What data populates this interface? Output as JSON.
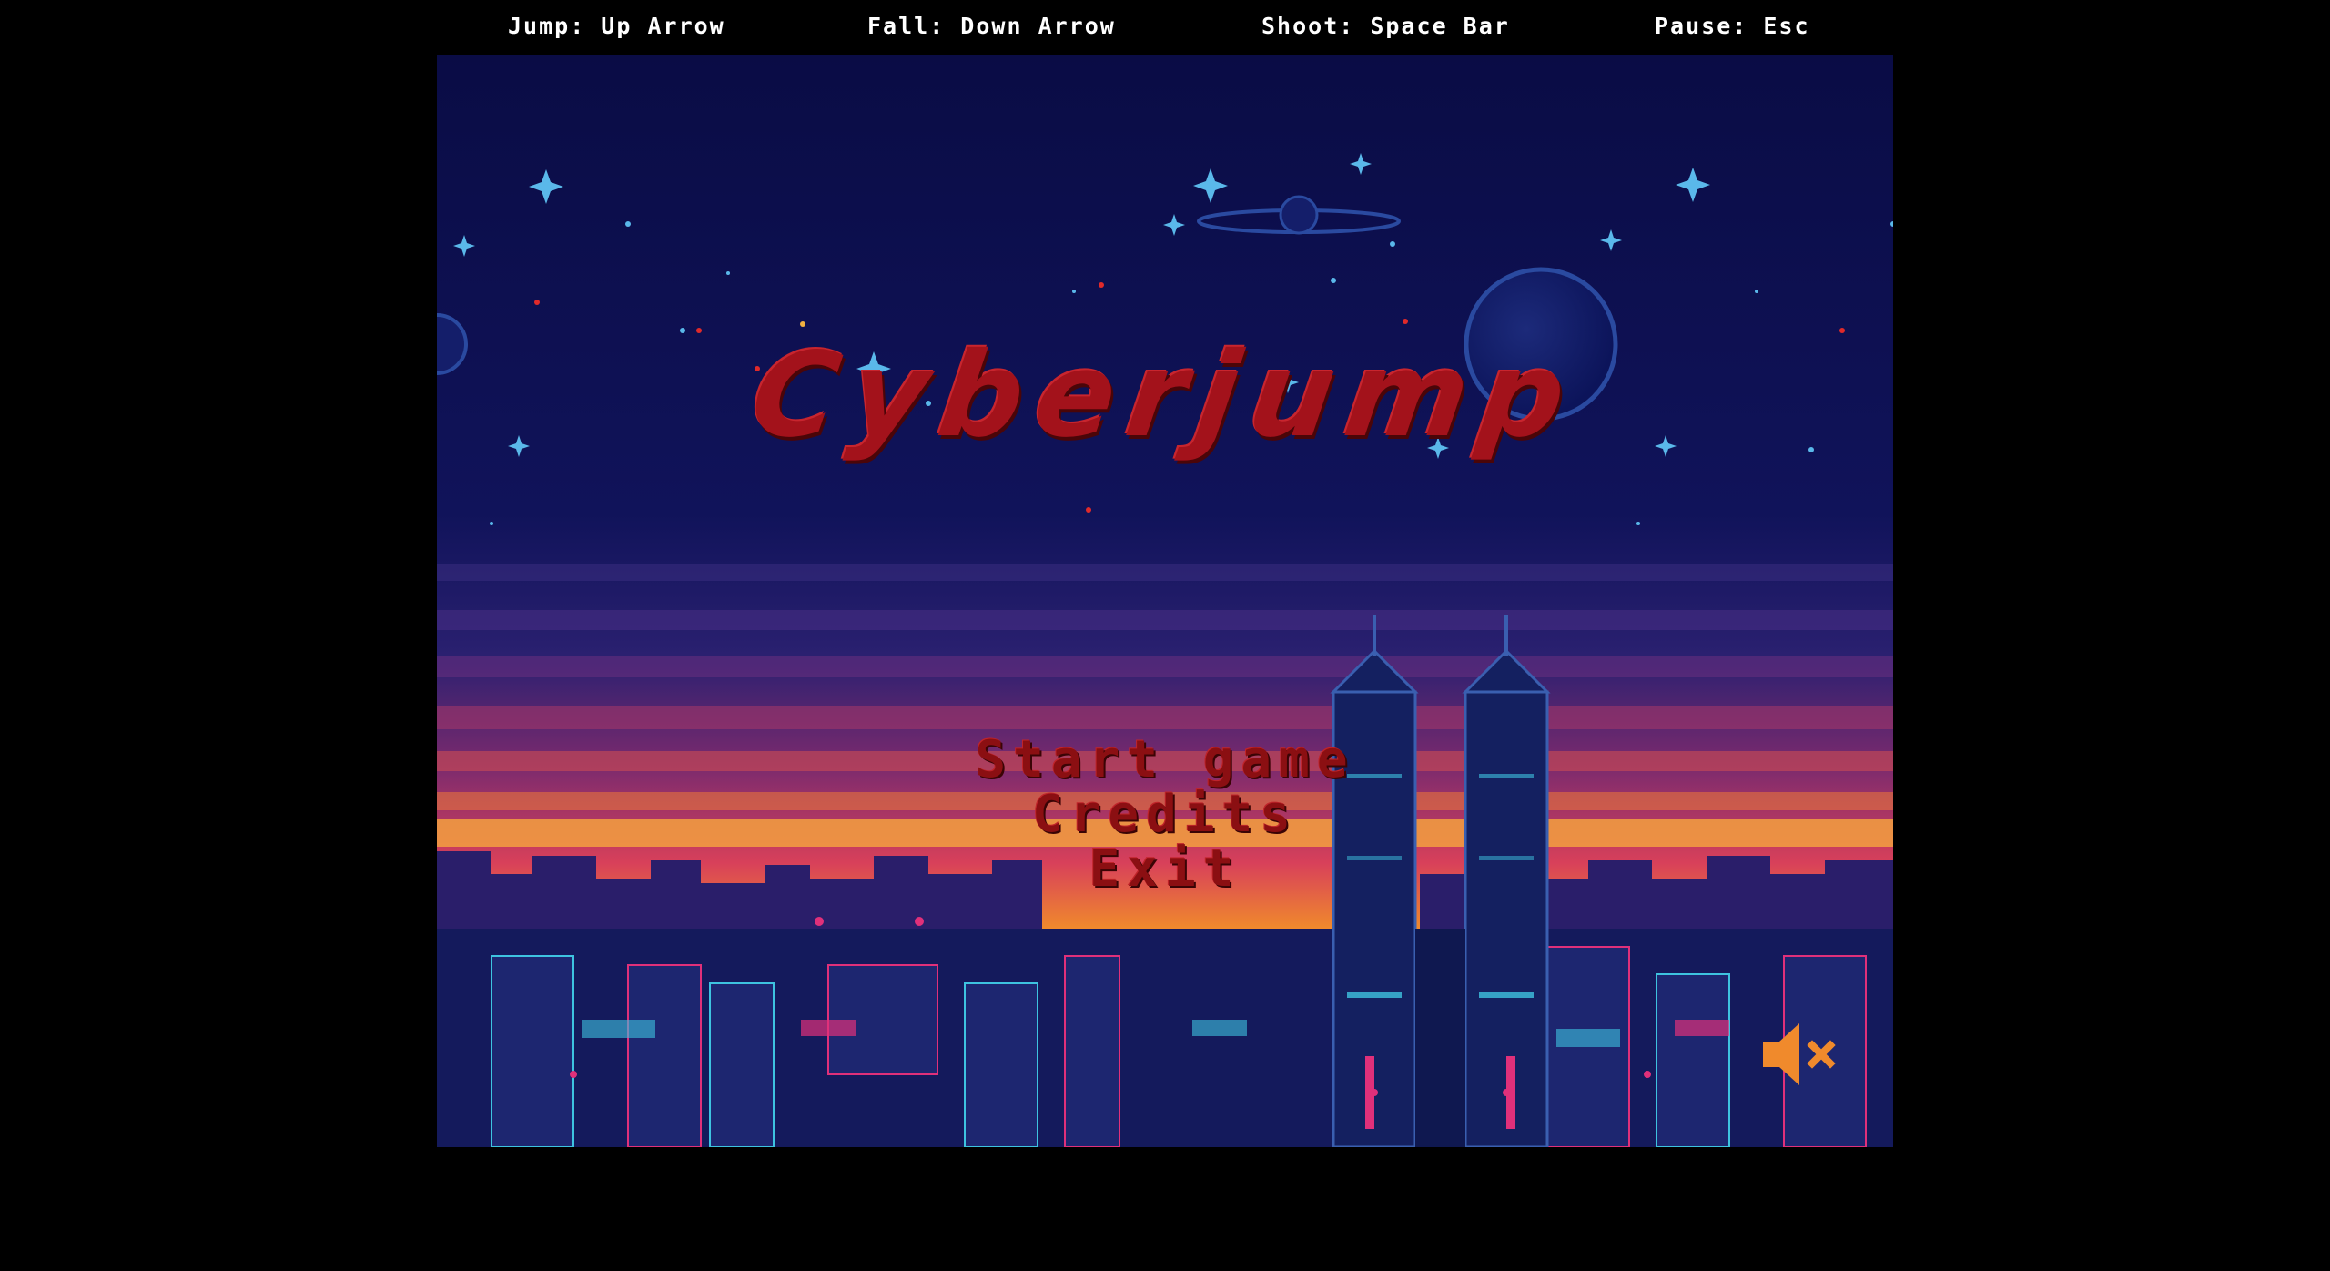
{
  "controls": {
    "jump": "Jump: Up Arrow",
    "fall": "Fall: Down Arrow",
    "shoot": "Shoot: Space Bar",
    "pause": "Pause: Esc"
  },
  "game": {
    "title": "Cyberjump",
    "menu": {
      "start": "Start game",
      "credits": "Credits",
      "exit": "Exit"
    },
    "sound_icon": "speaker-muted-icon"
  },
  "colors": {
    "page_background": "#000000",
    "sky": "#0c0f4d",
    "title_red": "#a3121b",
    "menu_red": "#8b0f12",
    "sunset_orange": "#f08a2c",
    "neon_pink": "#e0307a",
    "neon_cyan": "#3ec3e0",
    "speaker_orange": "#f08a2c"
  }
}
